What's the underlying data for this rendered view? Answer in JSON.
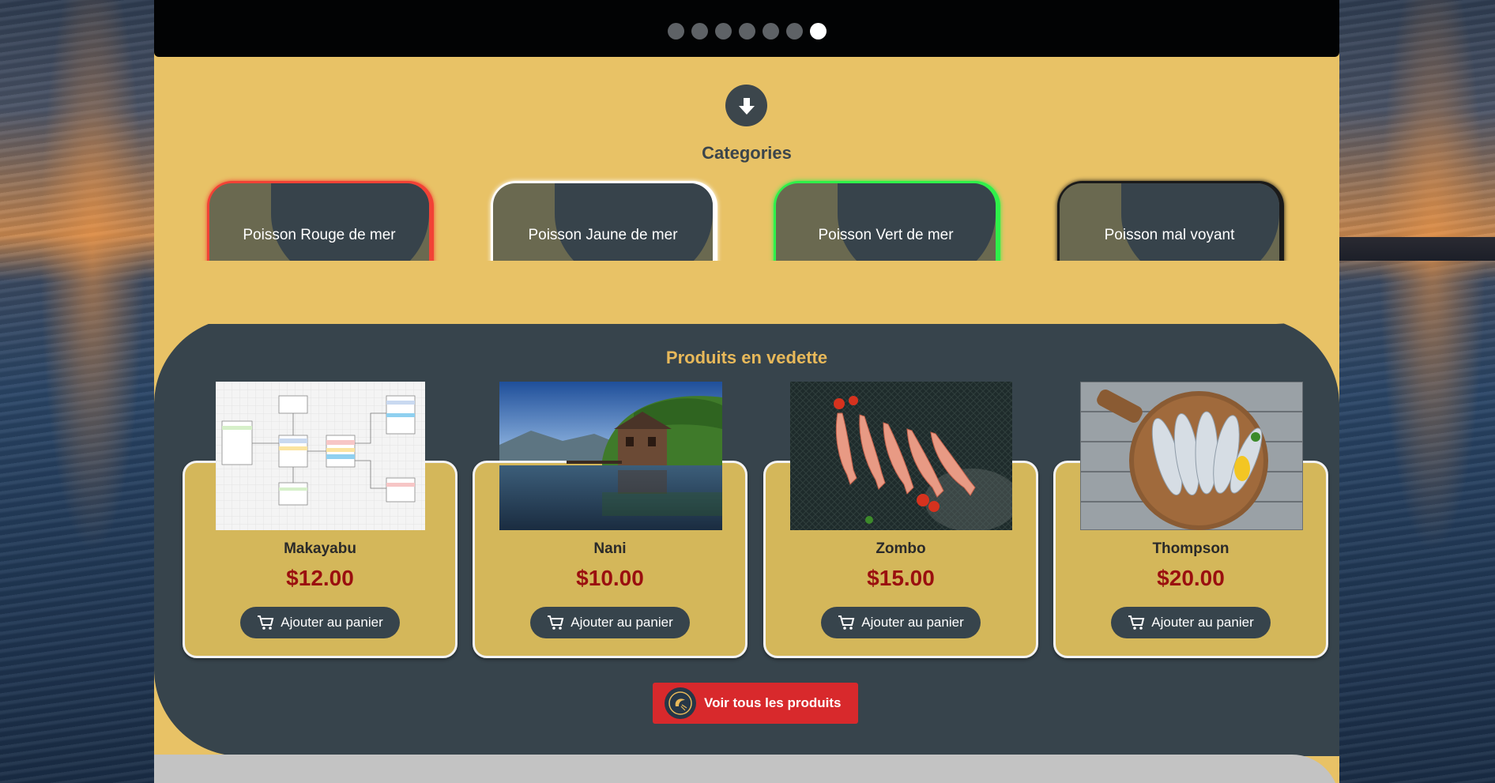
{
  "carousel": {
    "slides": 7,
    "active_index": 6
  },
  "categories": {
    "title": "Categories",
    "items": [
      {
        "label": "Poisson Rouge de mer",
        "accent": "#f24236"
      },
      {
        "label": "Poisson Jaune de mer",
        "accent": "#ffffff"
      },
      {
        "label": "Poisson Vert de mer",
        "accent": "#2ff04a"
      },
      {
        "label": "Poisson mal voyant",
        "accent": "#1a1a1a"
      }
    ]
  },
  "featured": {
    "title": "Produits en vedette",
    "products": [
      {
        "name": "Makayabu",
        "price": "$12.00",
        "image": "diagram-image",
        "cart_label": "Ajouter au panier"
      },
      {
        "name": "Nani",
        "price": "$10.00",
        "image": "lake-house-image",
        "cart_label": "Ajouter au panier"
      },
      {
        "name": "Zombo",
        "price": "$15.00",
        "image": "red-fish-image",
        "cart_label": "Ajouter au panier"
      },
      {
        "name": "Thompson",
        "price": "$20.00",
        "image": "fish-board-image",
        "cart_label": "Ajouter au panier"
      }
    ],
    "view_all_label": "Voir tous les produits"
  },
  "colors": {
    "yellow": "#e8c266",
    "dark": "#37444c",
    "price": "#9a0f0f",
    "red_button": "#d8292c"
  }
}
